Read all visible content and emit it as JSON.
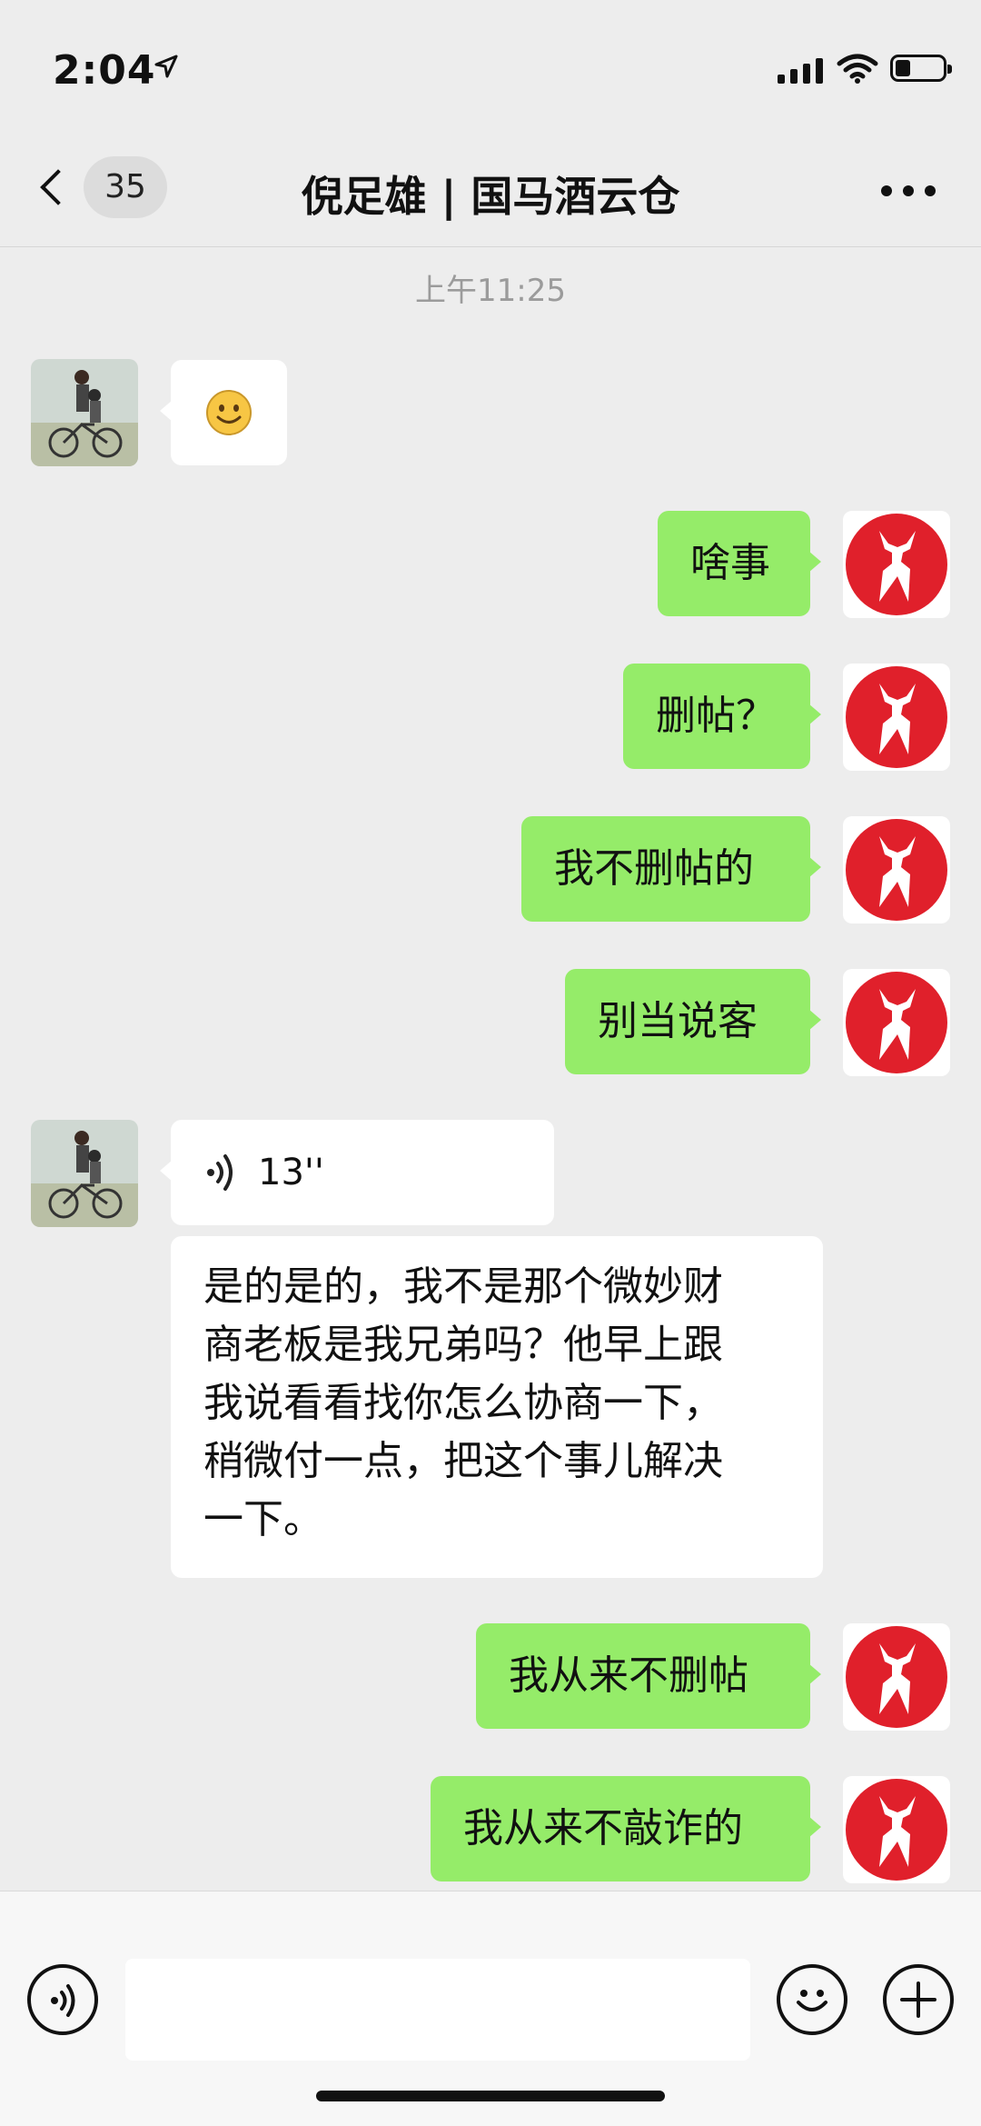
{
  "status_bar": {
    "time": "2:04",
    "icons": [
      "location-arrow-icon",
      "signal-icon",
      "wifi-icon",
      "battery-icon"
    ]
  },
  "nav": {
    "unread_count": "35",
    "title": "倪足雄 | 国马酒云仓",
    "back_icon": "chevron-left-icon",
    "more_icon": "more-dots-icon"
  },
  "chat": {
    "timestamp": "上午11:25",
    "messages": [
      {
        "from": "them",
        "type": "emoji",
        "text": "😊"
      },
      {
        "from": "me",
        "type": "text",
        "text": "啥事"
      },
      {
        "from": "me",
        "type": "text",
        "text": "删帖？"
      },
      {
        "from": "me",
        "type": "text",
        "text": "我不删帖的"
      },
      {
        "from": "me",
        "type": "text",
        "text": "别当说客"
      },
      {
        "from": "them",
        "type": "voice",
        "duration": "13''"
      },
      {
        "from": "them",
        "type": "transcript",
        "lines": [
          "是的是的，我不是那个微妙财",
          "商老板是我兄弟吗？他早上跟",
          "我说看看找你怎么协商一下，",
          "稍微付一点，把这个事儿解决",
          "一下。"
        ]
      },
      {
        "from": "me",
        "type": "text",
        "text": "我从来不删帖"
      },
      {
        "from": "me",
        "type": "text",
        "text": "我从来不敲诈的"
      }
    ]
  },
  "input_bar": {
    "voice_icon": "voice-icon",
    "emoji_icon": "smiley-icon",
    "plus_icon": "plus-icon"
  },
  "colors": {
    "background": "#ededed",
    "my_bubble": "#95ec69",
    "their_bubble": "#ffffff",
    "avatar_red": "#e0202b"
  }
}
